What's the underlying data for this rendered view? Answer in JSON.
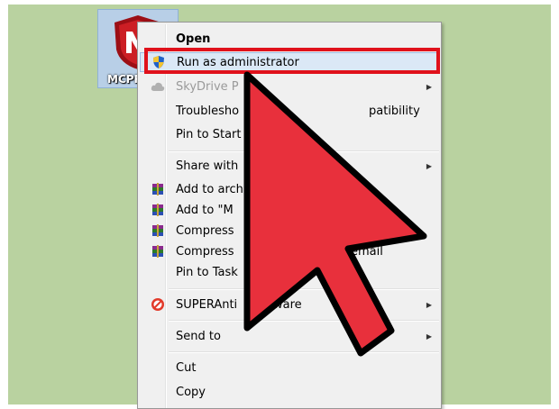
{
  "desktop_icon": {
    "label": "MCPR"
  },
  "menu": {
    "items": [
      {
        "label": "Open"
      },
      {
        "label": "Run as administrator"
      },
      {
        "label": "SkyDrive P"
      },
      {
        "label": "Troublesho",
        "label2": "patibility"
      },
      {
        "label": "Pin to Start"
      },
      {
        "label": "Share with"
      },
      {
        "label": "Add to arch"
      },
      {
        "label": "Add to \"M"
      },
      {
        "label": "Compress"
      },
      {
        "label": "Compress",
        "label2": "email"
      },
      {
        "label": "Pin to Task"
      },
      {
        "label": "SUPERAnti",
        "label2": "ware"
      },
      {
        "label": "Send to"
      },
      {
        "label": "Cut"
      },
      {
        "label": "Copy"
      }
    ]
  },
  "colors": {
    "desktop": "#b9d2a0",
    "highlight_box": "#e0111b",
    "pointer_arrow": "#e8303c"
  },
  "icons": [
    "uac-shield-icon",
    "cloud-icon",
    "winrar-icon",
    "no-entry-icon",
    "chevron-right-icon",
    "big-pointer-arrow-icon"
  ]
}
